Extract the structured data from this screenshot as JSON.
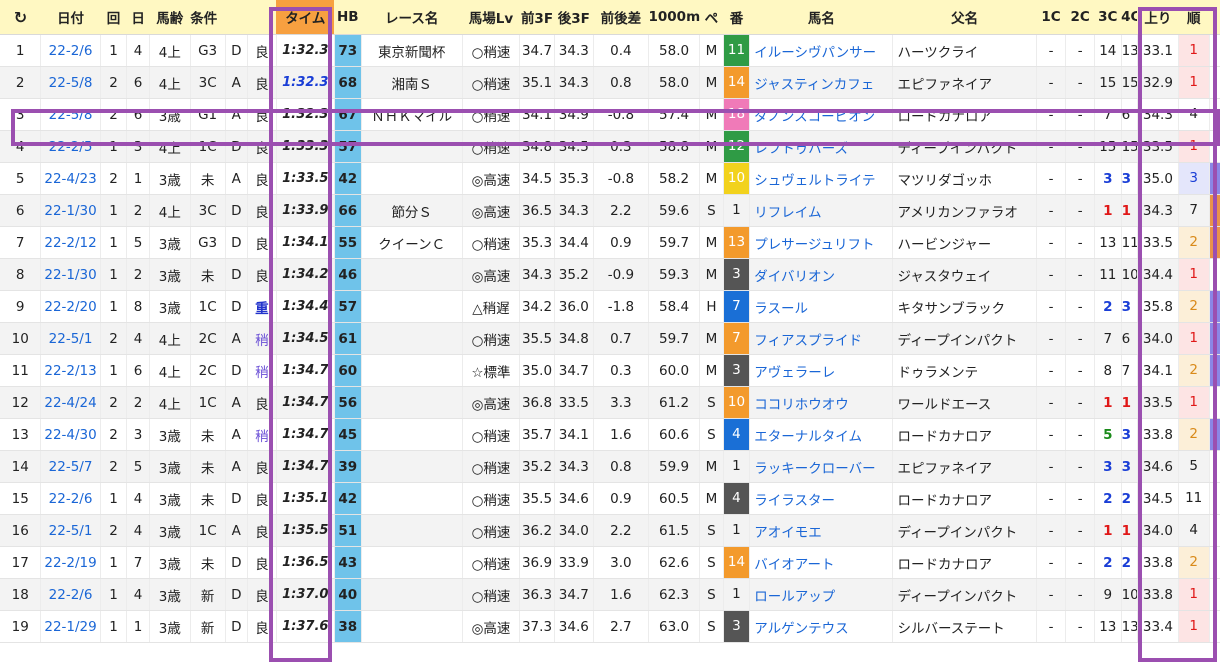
{
  "headers": {
    "refresh_icon": "↻",
    "no": "",
    "date": "日付",
    "kai": "回",
    "nichi": "日",
    "age": "馬齢",
    "cond": "条件",
    "course": "",
    "baba": "",
    "time": "タイム",
    "hb": "HB",
    "race": "レース名",
    "lv": "馬場Lv",
    "f3": "前3F",
    "l3": "後3F",
    "diff": "前後差",
    "m1000": "1000m",
    "pace": "ペ",
    "ban": "番",
    "name": "馬名",
    "sire": "父名",
    "c1": "1C",
    "c2": "2C",
    "c3": "3C",
    "c4": "4C",
    "agari": "上り",
    "jun": "順"
  },
  "colors": {
    "frame": "#9b4fb0",
    "time_header": "#f7a040",
    "hb_bg": "#6fc3ea",
    "header_bg": "#fff8c2",
    "link": "#1a66d6",
    "rank1_bg": "#fde4e4",
    "rank2_bg": "#fcefd8",
    "rank3_bg": "#e4e6fb"
  },
  "rows": [
    {
      "no": "1",
      "date": "22-2/6",
      "kai": "1",
      "nichi": "4",
      "age": "4上",
      "cond": "G3",
      "course": "D",
      "baba": "良",
      "time": "1:32.3",
      "time_blue": false,
      "hb": "73",
      "race": "東京新聞杯",
      "lv": "○稍速",
      "f3": "34.7",
      "l3": "34.3",
      "diff": "0.4",
      "m1000": "58.0",
      "pace": "M",
      "ban": "11",
      "ban_color": "#2f9b45",
      "name": "イルーシヴパンサー",
      "sire": "ハーツクライ",
      "c1": "-",
      "c2": "-",
      "c3": "14",
      "c3_style": "",
      "c4": "13",
      "c4_style": "",
      "agari": "33.1",
      "jun": "1",
      "rank_bg": "#fde4e4",
      "rank_color": "#e01818",
      "edge": "#ffffff"
    },
    {
      "no": "2",
      "date": "22-5/8",
      "kai": "2",
      "nichi": "6",
      "age": "4上",
      "cond": "3C",
      "course": "A",
      "baba": "良",
      "time": "1:32.3",
      "time_blue": true,
      "hb": "68",
      "race": "湘南Ｓ",
      "lv": "○稍速",
      "f3": "35.1",
      "l3": "34.3",
      "diff": "0.8",
      "m1000": "58.0",
      "pace": "M",
      "ban": "14",
      "ban_color": "#f39a2c",
      "name": "ジャスティンカフェ",
      "sire": "エピファネイア",
      "c1": "-",
      "c2": "-",
      "c3": "15",
      "c3_style": "",
      "c4": "15",
      "c4_style": "",
      "agari": "32.9",
      "jun": "1",
      "rank_bg": "#fde4e4",
      "rank_color": "#e01818",
      "edge": "#ffffff"
    },
    {
      "no": "3",
      "date": "22-5/8",
      "kai": "2",
      "nichi": "6",
      "age": "3歳",
      "cond": "G1",
      "course": "A",
      "baba": "良",
      "time": "1:32.3",
      "time_blue": false,
      "hb": "67",
      "race": "ＮＨＫマイル",
      "lv": "○稍速",
      "f3": "34.1",
      "l3": "34.9",
      "diff": "-0.8",
      "m1000": "57.4",
      "pace": "M",
      "ban": "18",
      "ban_color": "#f07ab8",
      "name": "ダノンスコーピオン",
      "sire": "ロードカナロア",
      "c1": "-",
      "c2": "-",
      "c3": "7",
      "c3_style": "",
      "c4": "6",
      "c4_style": "",
      "agari": "34.3",
      "jun": "4",
      "rank_bg": "transparent",
      "rank_color": "#222222",
      "edge": "#ffffff"
    },
    {
      "no": "4",
      "date": "22-2/5",
      "kai": "1",
      "nichi": "3",
      "age": "4上",
      "cond": "1C",
      "course": "D",
      "baba": "良",
      "time": "1:33.3",
      "time_blue": false,
      "hb": "57",
      "race": "",
      "lv": "○稍速",
      "f3": "34.8",
      "l3": "34.5",
      "diff": "0.3",
      "m1000": "58.8",
      "pace": "M",
      "ban": "12",
      "ban_color": "#2f9b45",
      "name": "レフトゥバーズ",
      "sire": "ディープインパクト",
      "c1": "-",
      "c2": "-",
      "c3": "15",
      "c3_style": "",
      "c4": "15",
      "c4_style": "",
      "agari": "33.5",
      "jun": "1",
      "rank_bg": "#fde4e4",
      "rank_color": "#e01818",
      "edge": "#ffffff"
    },
    {
      "no": "5",
      "date": "22-4/23",
      "kai": "2",
      "nichi": "1",
      "age": "3歳",
      "cond": "未",
      "course": "A",
      "baba": "良",
      "time": "1:33.5",
      "time_blue": false,
      "hb": "42",
      "race": "",
      "lv": "◎高速",
      "f3": "34.5",
      "l3": "35.3",
      "diff": "-0.8",
      "m1000": "58.2",
      "pace": "M",
      "ban": "10",
      "ban_color": "#f2d21d",
      "name": "シュヴェルトライテ",
      "sire": "マツリダゴッホ",
      "c1": "-",
      "c2": "-",
      "c3": "3",
      "c3_style": "mark-blue",
      "c4": "3",
      "c4_style": "mark-blue",
      "agari": "35.0",
      "jun": "3",
      "rank_bg": "#e4e6fb",
      "rank_color": "#1a3ed6",
      "edge": "#8a86e6"
    },
    {
      "no": "6",
      "date": "22-1/30",
      "kai": "1",
      "nichi": "2",
      "age": "4上",
      "cond": "3C",
      "course": "D",
      "baba": "良",
      "time": "1:33.9",
      "time_blue": false,
      "hb": "66",
      "race": "節分Ｓ",
      "lv": "◎高速",
      "f3": "36.5",
      "l3": "34.3",
      "diff": "2.2",
      "m1000": "59.6",
      "pace": "S",
      "ban": "1",
      "ban_color": "transparent",
      "name": "リフレイム",
      "sire": "アメリカンファラオ",
      "c1": "-",
      "c2": "-",
      "c3": "1",
      "c3_style": "mark-red",
      "c4": "1",
      "c4_style": "mark-red",
      "agari": "34.3",
      "jun": "7",
      "rank_bg": "transparent",
      "rank_color": "#222222",
      "edge": "#e8924a"
    },
    {
      "no": "7",
      "date": "22-2/12",
      "kai": "1",
      "nichi": "5",
      "age": "3歳",
      "cond": "G3",
      "course": "D",
      "baba": "良",
      "time": "1:34.1",
      "time_blue": false,
      "hb": "55",
      "race": "クイーンＣ",
      "lv": "○稍速",
      "f3": "35.3",
      "l3": "34.4",
      "diff": "0.9",
      "m1000": "59.7",
      "pace": "M",
      "ban": "13",
      "ban_color": "#f39a2c",
      "name": "プレサージュリフト",
      "sire": "ハービンジャー",
      "c1": "-",
      "c2": "-",
      "c3": "13",
      "c3_style": "",
      "c4": "11",
      "c4_style": "",
      "agari": "33.5",
      "jun": "2",
      "rank_bg": "#fcefd8",
      "rank_color": "#d98a1a",
      "edge": "#e8924a"
    },
    {
      "no": "8",
      "date": "22-1/30",
      "kai": "1",
      "nichi": "2",
      "age": "3歳",
      "cond": "未",
      "course": "D",
      "baba": "良",
      "time": "1:34.2",
      "time_blue": false,
      "hb": "46",
      "race": "",
      "lv": "◎高速",
      "f3": "34.3",
      "l3": "35.2",
      "diff": "-0.9",
      "m1000": "59.3",
      "pace": "M",
      "ban": "3",
      "ban_color": "#555555",
      "name": "ダイバリオン",
      "sire": "ジャスタウェイ",
      "c1": "-",
      "c2": "-",
      "c3": "11",
      "c3_style": "",
      "c4": "10",
      "c4_style": "",
      "agari": "34.4",
      "jun": "1",
      "rank_bg": "#fde4e4",
      "rank_color": "#e01818",
      "edge": "#ffffff"
    },
    {
      "no": "9",
      "date": "22-2/20",
      "kai": "1",
      "nichi": "8",
      "age": "3歳",
      "cond": "1C",
      "course": "D",
      "baba": "重",
      "time": "1:34.4",
      "time_blue": false,
      "hb": "57",
      "race": "",
      "lv": "△稍遅",
      "f3": "34.2",
      "l3": "36.0",
      "diff": "-1.8",
      "m1000": "58.4",
      "pace": "H",
      "ban": "7",
      "ban_color": "#1a6fd6",
      "name": "ラスール",
      "sire": "キタサンブラック",
      "c1": "-",
      "c2": "-",
      "c3": "2",
      "c3_style": "mark-blue",
      "c4": "3",
      "c4_style": "mark-blue",
      "agari": "35.8",
      "jun": "2",
      "rank_bg": "#fcefd8",
      "rank_color": "#d98a1a",
      "edge": "#8a86e6"
    },
    {
      "no": "10",
      "date": "22-5/1",
      "kai": "2",
      "nichi": "4",
      "age": "4上",
      "cond": "2C",
      "course": "A",
      "baba": "稍",
      "time": "1:34.5",
      "time_blue": false,
      "hb": "61",
      "race": "",
      "lv": "○稍速",
      "f3": "35.5",
      "l3": "34.8",
      "diff": "0.7",
      "m1000": "59.7",
      "pace": "M",
      "ban": "7",
      "ban_color": "#f39a2c",
      "name": "フィアスプライド",
      "sire": "ディープインパクト",
      "c1": "-",
      "c2": "-",
      "c3": "7",
      "c3_style": "",
      "c4": "6",
      "c4_style": "",
      "agari": "34.0",
      "jun": "1",
      "rank_bg": "#fde4e4",
      "rank_color": "#e01818",
      "edge": "#8a86e6"
    },
    {
      "no": "11",
      "date": "22-2/13",
      "kai": "1",
      "nichi": "6",
      "age": "4上",
      "cond": "2C",
      "course": "D",
      "baba": "稍",
      "time": "1:34.7",
      "time_blue": false,
      "hb": "60",
      "race": "",
      "lv": "☆標準",
      "f3": "35.0",
      "l3": "34.7",
      "diff": "0.3",
      "m1000": "60.0",
      "pace": "M",
      "ban": "3",
      "ban_color": "#555555",
      "name": "アヴェラーレ",
      "sire": "ドゥラメンテ",
      "c1": "-",
      "c2": "-",
      "c3": "8",
      "c3_style": "",
      "c4": "7",
      "c4_style": "",
      "agari": "34.1",
      "jun": "2",
      "rank_bg": "#fcefd8",
      "rank_color": "#d98a1a",
      "edge": "#8a86e6"
    },
    {
      "no": "12",
      "date": "22-4/24",
      "kai": "2",
      "nichi": "2",
      "age": "4上",
      "cond": "1C",
      "course": "A",
      "baba": "良",
      "time": "1:34.7",
      "time_blue": false,
      "hb": "56",
      "race": "",
      "lv": "◎高速",
      "f3": "36.8",
      "l3": "33.5",
      "diff": "3.3",
      "m1000": "61.2",
      "pace": "S",
      "ban": "10",
      "ban_color": "#f39a2c",
      "name": "ココリホウオウ",
      "sire": "ワールドエース",
      "c1": "-",
      "c2": "-",
      "c3": "1",
      "c3_style": "mark-red",
      "c4": "1",
      "c4_style": "mark-red",
      "agari": "33.5",
      "jun": "1",
      "rank_bg": "#fde4e4",
      "rank_color": "#e01818",
      "edge": "#ffffff"
    },
    {
      "no": "13",
      "date": "22-4/30",
      "kai": "2",
      "nichi": "3",
      "age": "3歳",
      "cond": "未",
      "course": "A",
      "baba": "稍",
      "time": "1:34.7",
      "time_blue": false,
      "hb": "45",
      "race": "",
      "lv": "○稍速",
      "f3": "35.7",
      "l3": "34.1",
      "diff": "1.6",
      "m1000": "60.6",
      "pace": "S",
      "ban": "4",
      "ban_color": "#1a6fd6",
      "name": "エターナルタイム",
      "sire": "ロードカナロア",
      "c1": "-",
      "c2": "-",
      "c3": "5",
      "c3_style": "mark-green",
      "c4": "3",
      "c4_style": "mark-blue",
      "agari": "33.8",
      "jun": "2",
      "rank_bg": "#fcefd8",
      "rank_color": "#d98a1a",
      "edge": "#8a86e6"
    },
    {
      "no": "14",
      "date": "22-5/7",
      "kai": "2",
      "nichi": "5",
      "age": "3歳",
      "cond": "未",
      "course": "A",
      "baba": "良",
      "time": "1:34.7",
      "time_blue": false,
      "hb": "39",
      "race": "",
      "lv": "○稍速",
      "f3": "35.2",
      "l3": "34.3",
      "diff": "0.8",
      "m1000": "59.9",
      "pace": "M",
      "ban": "1",
      "ban_color": "transparent",
      "name": "ラッキークローバー",
      "sire": "エピファネイア",
      "c1": "-",
      "c2": "-",
      "c3": "3",
      "c3_style": "mark-blue",
      "c4": "3",
      "c4_style": "mark-blue",
      "agari": "34.6",
      "jun": "5",
      "rank_bg": "transparent",
      "rank_color": "#222222",
      "edge": "#ffffff"
    },
    {
      "no": "15",
      "date": "22-2/6",
      "kai": "1",
      "nichi": "4",
      "age": "3歳",
      "cond": "未",
      "course": "D",
      "baba": "良",
      "time": "1:35.1",
      "time_blue": false,
      "hb": "42",
      "race": "",
      "lv": "○稍速",
      "f3": "35.5",
      "l3": "34.6",
      "diff": "0.9",
      "m1000": "60.5",
      "pace": "M",
      "ban": "4",
      "ban_color": "#555555",
      "name": "ライラスター",
      "sire": "ロードカナロア",
      "c1": "-",
      "c2": "-",
      "c3": "2",
      "c3_style": "mark-blue",
      "c4": "2",
      "c4_style": "mark-blue",
      "agari": "34.5",
      "jun": "11",
      "rank_bg": "transparent",
      "rank_color": "#222222",
      "edge": "#ffffff"
    },
    {
      "no": "16",
      "date": "22-5/1",
      "kai": "2",
      "nichi": "4",
      "age": "3歳",
      "cond": "1C",
      "course": "A",
      "baba": "良",
      "time": "1:35.5",
      "time_blue": false,
      "hb": "51",
      "race": "",
      "lv": "○稍速",
      "f3": "36.2",
      "l3": "34.0",
      "diff": "2.2",
      "m1000": "61.5",
      "pace": "S",
      "ban": "1",
      "ban_color": "transparent",
      "name": "アオイモエ",
      "sire": "ディープインパクト",
      "c1": "-",
      "c2": "-",
      "c3": "1",
      "c3_style": "mark-red",
      "c4": "1",
      "c4_style": "mark-red",
      "agari": "34.0",
      "jun": "4",
      "rank_bg": "transparent",
      "rank_color": "#222222",
      "edge": "#ffffff"
    },
    {
      "no": "17",
      "date": "22-2/19",
      "kai": "1",
      "nichi": "7",
      "age": "3歳",
      "cond": "未",
      "course": "D",
      "baba": "良",
      "time": "1:36.5",
      "time_blue": false,
      "hb": "43",
      "race": "",
      "lv": "○稍速",
      "f3": "36.9",
      "l3": "33.9",
      "diff": "3.0",
      "m1000": "62.6",
      "pace": "S",
      "ban": "14",
      "ban_color": "#f39a2c",
      "name": "バイオアート",
      "sire": "ロードカナロア",
      "c1": "-",
      "c2": "-",
      "c3": "2",
      "c3_style": "mark-blue",
      "c4": "2",
      "c4_style": "mark-blue",
      "agari": "33.8",
      "jun": "2",
      "rank_bg": "#fcefd8",
      "rank_color": "#d98a1a",
      "edge": "#ffffff"
    },
    {
      "no": "18",
      "date": "22-2/6",
      "kai": "1",
      "nichi": "4",
      "age": "3歳",
      "cond": "新",
      "course": "D",
      "baba": "良",
      "time": "1:37.0",
      "time_blue": false,
      "hb": "40",
      "race": "",
      "lv": "○稍速",
      "f3": "36.3",
      "l3": "34.7",
      "diff": "1.6",
      "m1000": "62.3",
      "pace": "S",
      "ban": "1",
      "ban_color": "transparent",
      "name": "ロールアップ",
      "sire": "ディープインパクト",
      "c1": "-",
      "c2": "-",
      "c3": "9",
      "c3_style": "",
      "c4": "10",
      "c4_style": "",
      "agari": "33.8",
      "jun": "1",
      "rank_bg": "#fde4e4",
      "rank_color": "#e01818",
      "edge": "#ffffff"
    },
    {
      "no": "19",
      "date": "22-1/29",
      "kai": "1",
      "nichi": "1",
      "age": "3歳",
      "cond": "新",
      "course": "D",
      "baba": "良",
      "time": "1:37.6",
      "time_blue": false,
      "hb": "38",
      "race": "",
      "lv": "◎高速",
      "f3": "37.3",
      "l3": "34.6",
      "diff": "2.7",
      "m1000": "63.0",
      "pace": "S",
      "ban": "3",
      "ban_color": "#555555",
      "name": "アルゲンテウス",
      "sire": "シルバーステート",
      "c1": "-",
      "c2": "-",
      "c3": "13",
      "c3_style": "",
      "c4": "13",
      "c4_style": "",
      "agari": "33.4",
      "jun": "1",
      "rank_bg": "#fde4e4",
      "rank_color": "#e01818",
      "edge": "#ffffff"
    }
  ]
}
